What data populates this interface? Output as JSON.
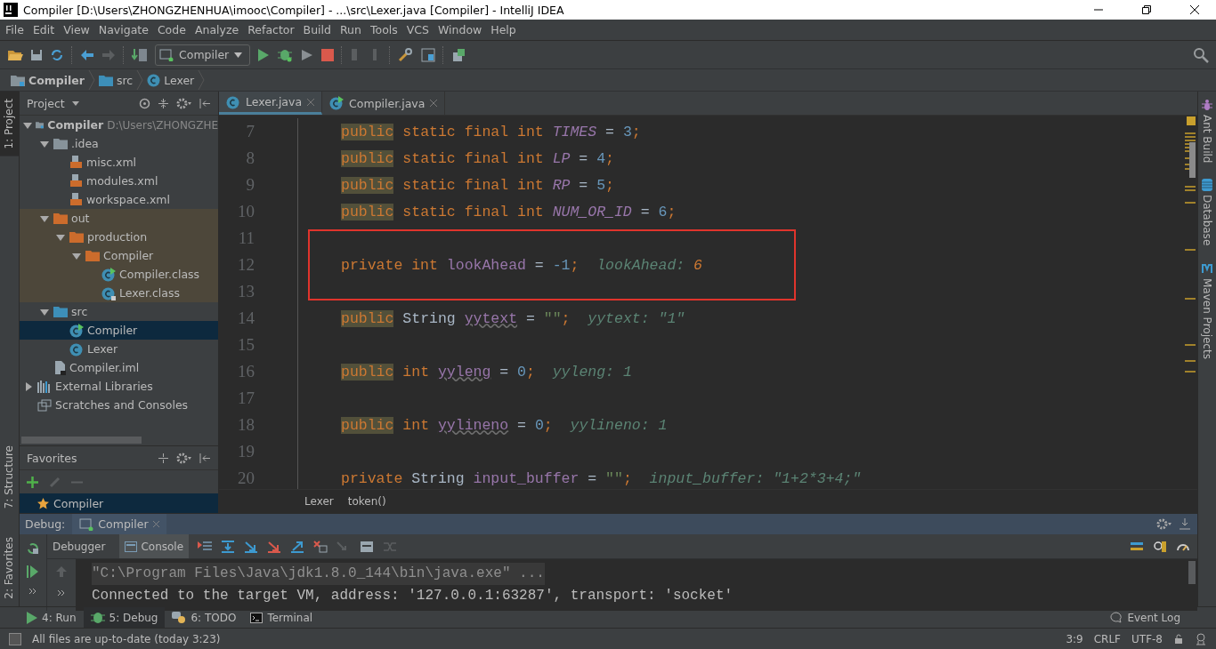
{
  "window": {
    "title": "Compiler [D:\\Users\\ZHONGZHENHUA\\imooc\\Compiler] - ...\\src\\Lexer.java [Compiler] - IntelliJ IDEA"
  },
  "menu": [
    "File",
    "Edit",
    "View",
    "Navigate",
    "Code",
    "Analyze",
    "Refactor",
    "Build",
    "Run",
    "Tools",
    "VCS",
    "Window",
    "Help"
  ],
  "toolbar": {
    "run_config": "Compiler"
  },
  "nav_bar": [
    {
      "label": "Compiler",
      "kind": "module"
    },
    {
      "label": "src",
      "kind": "folder_src"
    },
    {
      "label": "Lexer",
      "kind": "class"
    }
  ],
  "left_strip": {
    "top": [
      {
        "label": "1: Project",
        "selected": true
      }
    ],
    "bottom": [
      {
        "label": "7: Structure",
        "selected": false
      },
      {
        "label": "2: Favorites",
        "selected": false
      }
    ]
  },
  "right_strip": [
    {
      "label": "Ant Build",
      "kind": "ant"
    },
    {
      "label": "Database",
      "kind": "database"
    },
    {
      "label": "Maven Projects",
      "kind": "maven"
    }
  ],
  "project": {
    "title": "Project",
    "tree": [
      {
        "label": "Compiler",
        "kind": "module",
        "hint": "D:\\Users\\ZHONGZHE",
        "expanded": true,
        "selected": false,
        "children": [
          {
            "label": ".idea",
            "kind": "folder",
            "expanded": true,
            "selected": false,
            "children": [
              {
                "label": "misc.xml",
                "kind": "xml",
                "selected": false
              },
              {
                "label": "modules.xml",
                "kind": "xml",
                "selected": false
              },
              {
                "label": "workspace.xml",
                "kind": "xml",
                "selected": false
              }
            ]
          },
          {
            "label": "out",
            "kind": "folder_excluded",
            "expanded": true,
            "selected": false,
            "excluded": true,
            "children": [
              {
                "label": "production",
                "kind": "folder_excluded",
                "expanded": true,
                "selected": false,
                "children": [
                  {
                    "label": "Compiler",
                    "kind": "folder_excluded",
                    "expanded": true,
                    "selected": false,
                    "children": [
                      {
                        "label": "Compiler.class",
                        "kind": "class_main",
                        "selected": false
                      },
                      {
                        "label": "Lexer.class",
                        "kind": "class_locked",
                        "selected": false
                      }
                    ]
                  }
                ]
              }
            ]
          },
          {
            "label": "src",
            "kind": "folder_src",
            "expanded": true,
            "selected": false,
            "children": [
              {
                "label": "Compiler",
                "kind": "class_main",
                "selected": true
              },
              {
                "label": "Lexer",
                "kind": "class",
                "selected": false
              }
            ]
          },
          {
            "label": "Compiler.iml",
            "kind": "iml",
            "selected": false
          }
        ]
      },
      {
        "label": "External Libraries",
        "kind": "libraries",
        "expanded": false,
        "selected": false
      },
      {
        "label": "Scratches and Consoles",
        "kind": "scratches",
        "selected": false
      }
    ]
  },
  "favorites": {
    "title": "Favorites",
    "items": [
      {
        "label": "Compiler",
        "selected": true
      }
    ]
  },
  "editor_tabs": [
    {
      "label": "Lexer.java",
      "kind": "class",
      "selected": true
    },
    {
      "label": "Compiler.java",
      "kind": "class_main",
      "selected": false
    }
  ],
  "code": [
    {
      "number": "7",
      "tokens": [
        {
          "text": "public",
          "kind": "kw_hl"
        },
        {
          "text": " static final int ",
          "kind": "kw"
        },
        {
          "text": "TIMES",
          "kind": "const"
        },
        {
          "text": " = ",
          "kind": "plain"
        },
        {
          "text": "3",
          "kind": "num"
        },
        {
          "text": ";",
          "kind": "kw"
        }
      ]
    },
    {
      "number": "8",
      "tokens": [
        {
          "text": "public",
          "kind": "kw_hl"
        },
        {
          "text": " static final int ",
          "kind": "kw"
        },
        {
          "text": "LP",
          "kind": "const"
        },
        {
          "text": " = ",
          "kind": "plain"
        },
        {
          "text": "4",
          "kind": "num"
        },
        {
          "text": ";",
          "kind": "kw"
        }
      ]
    },
    {
      "number": "9",
      "tokens": [
        {
          "text": "public",
          "kind": "kw_hl"
        },
        {
          "text": " static final int ",
          "kind": "kw"
        },
        {
          "text": "RP",
          "kind": "const"
        },
        {
          "text": " = ",
          "kind": "plain"
        },
        {
          "text": "5",
          "kind": "num"
        },
        {
          "text": ";",
          "kind": "kw"
        }
      ]
    },
    {
      "number": "10",
      "tokens": [
        {
          "text": "public",
          "kind": "kw_hl"
        },
        {
          "text": " static final int ",
          "kind": "kw"
        },
        {
          "text": "NUM_OR_ID",
          "kind": "const"
        },
        {
          "text": " = ",
          "kind": "plain"
        },
        {
          "text": "6",
          "kind": "num"
        },
        {
          "text": ";",
          "kind": "kw"
        }
      ]
    },
    {
      "number": "11"
    },
    {
      "number": "12",
      "boxed": true,
      "tokens": [
        {
          "text": "private int ",
          "kind": "kw"
        },
        {
          "text": "lookAhead",
          "kind": "field"
        },
        {
          "text": " = ",
          "kind": "plain"
        },
        {
          "text": "-1",
          "kind": "num"
        },
        {
          "text": ";",
          "kind": "kw"
        },
        {
          "text": "lookAhead: ",
          "kind": "hint"
        },
        {
          "text": "6",
          "kind": "hint_val"
        }
      ]
    },
    {
      "number": "13"
    },
    {
      "number": "14",
      "tokens": [
        {
          "text": "public",
          "kind": "kw_hl"
        },
        {
          "text": " String ",
          "kind": "plain"
        },
        {
          "text": "yytext",
          "kind": "field_warn"
        },
        {
          "text": " = ",
          "kind": "plain"
        },
        {
          "text": "\"\"",
          "kind": "str"
        },
        {
          "text": ";",
          "kind": "kw"
        },
        {
          "text": "yytext: \"1\"",
          "kind": "hint"
        }
      ]
    },
    {
      "number": "15"
    },
    {
      "number": "16",
      "tokens": [
        {
          "text": "public",
          "kind": "kw_hl"
        },
        {
          "text": " int ",
          "kind": "kw"
        },
        {
          "text": "yyleng",
          "kind": "field_warn"
        },
        {
          "text": " = ",
          "kind": "plain"
        },
        {
          "text": "0",
          "kind": "num"
        },
        {
          "text": ";",
          "kind": "kw"
        },
        {
          "text": "yyleng: 1",
          "kind": "hint"
        }
      ]
    },
    {
      "number": "17"
    },
    {
      "number": "18",
      "tokens": [
        {
          "text": "public",
          "kind": "kw_hl"
        },
        {
          "text": " int ",
          "kind": "kw"
        },
        {
          "text": "yylineno",
          "kind": "field_warn"
        },
        {
          "text": " = ",
          "kind": "plain"
        },
        {
          "text": "0",
          "kind": "num"
        },
        {
          "text": ";",
          "kind": "kw"
        },
        {
          "text": "yylineno: 1",
          "kind": "hint"
        }
      ]
    },
    {
      "number": "19"
    },
    {
      "number": "20",
      "tokens": [
        {
          "text": "private",
          "kind": "kw"
        },
        {
          "text": " String ",
          "kind": "plain"
        },
        {
          "text": "input_buffer",
          "kind": "field"
        },
        {
          "text": " = ",
          "kind": "plain"
        },
        {
          "text": "\"\"",
          "kind": "str"
        },
        {
          "text": ";",
          "kind": "kw"
        },
        {
          "text": "input_buffer: \"1+2*3+4;\"",
          "kind": "hint"
        }
      ]
    }
  ],
  "editor_breadcrumb": [
    "Lexer",
    "token()"
  ],
  "debug": {
    "label": "Debug:",
    "session": "Compiler",
    "tabs": [
      {
        "label": "Debugger",
        "selected": false
      },
      {
        "label": "Console",
        "selected": true
      }
    ],
    "console": [
      {
        "text": "\"C:\\Program Files\\Java\\jdk1.8.0_144\\bin\\java.exe\" ...",
        "kind": "command"
      },
      {
        "text": "Connected to the target VM, address: '127.0.0.1:63287', transport: 'socket'",
        "kind": "output"
      }
    ]
  },
  "tool_tabs": [
    {
      "label": "4: Run",
      "kind": "run",
      "selected": false
    },
    {
      "label": "5: Debug",
      "kind": "debug",
      "selected": true
    },
    {
      "label": "6: TODO",
      "kind": "todo",
      "selected": false
    },
    {
      "label": "Terminal",
      "kind": "terminal",
      "selected": false
    }
  ],
  "event_log": "Event Log",
  "status_bar": {
    "message": "All files are up-to-date (today 3:23)",
    "position": "3:9",
    "line_separator": "CRLF",
    "encoding": "UTF-8"
  }
}
